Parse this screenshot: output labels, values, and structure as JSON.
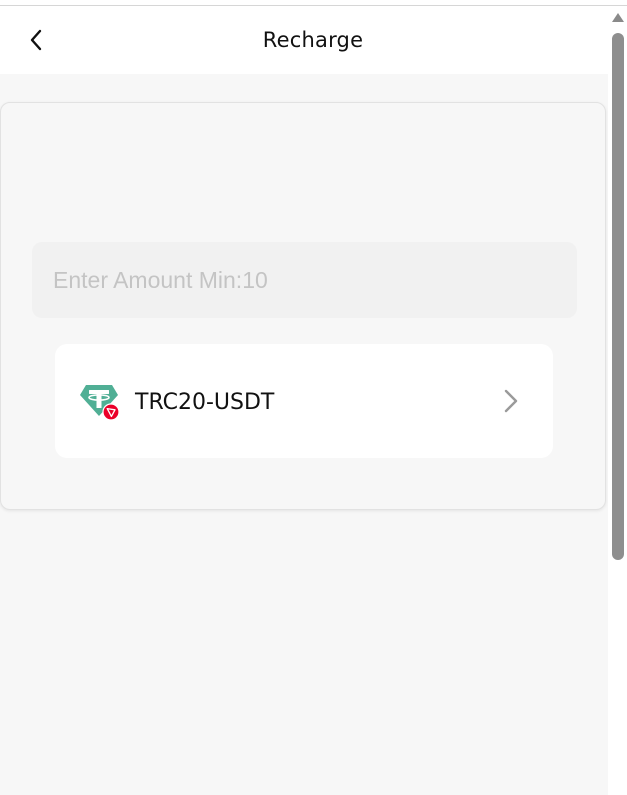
{
  "header": {
    "title": "Recharge",
    "back_icon": "chevron-left-icon"
  },
  "recharge_form": {
    "amount_input": {
      "value": "",
      "placeholder": "Enter Amount Min:10"
    },
    "network_option": {
      "label": "TRC20-USDT",
      "icon": "usdt-trc20-icon",
      "chevron_icon": "chevron-right-icon"
    }
  },
  "colors": {
    "usdt_green": "#50AF95",
    "tron_red": "#EB0029",
    "page_background": "#F7F7F7",
    "text_primary": "#111111",
    "placeholder": "#C4C4C4"
  }
}
